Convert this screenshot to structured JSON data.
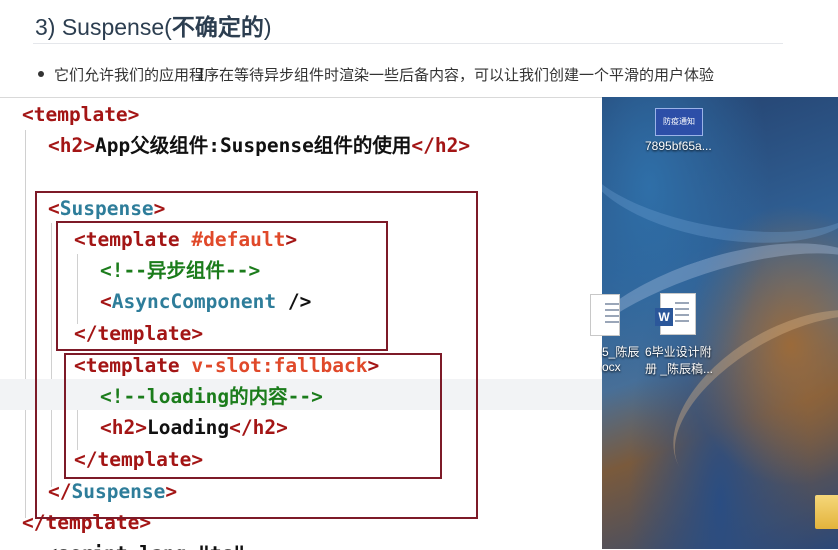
{
  "doc": {
    "heading_prefix": "3) Suspense(",
    "heading_bold": "不确定的",
    "heading_suffix": ")",
    "bullet_text": "它们允许我们的应用程序在等待异步组件时渲染一些后备内容，可以让我们创建一个平滑的用户体验"
  },
  "code": {
    "l1": {
      "open": "<",
      "tag": "template",
      "close": ">"
    },
    "l2": {
      "open": "<",
      "tag": "h2",
      "close": ">",
      "text": "App父级组件:Suspense组件的使用",
      "end_open": "</",
      "end_tag": "h2",
      "end_close": ">"
    },
    "l4": {
      "open": "<",
      "tag": "Suspense",
      "close": ">"
    },
    "l5": {
      "open": "<",
      "tag": "template",
      "attr": "#default",
      "close": ">"
    },
    "l6": {
      "comment": "<!--异步组件-->"
    },
    "l7": {
      "open": "<",
      "tag": "AsyncComponent",
      "close": " />"
    },
    "l8": {
      "open": "</",
      "tag": "template",
      "close": ">"
    },
    "l9": {
      "open": "<",
      "tag": "template",
      "attr": "v-slot:fallback",
      "close": ">"
    },
    "l10": {
      "comment": "<!--loading的内容-->"
    },
    "l11": {
      "open": "<",
      "tag": "h2",
      "close": ">",
      "text": "Loading",
      "end_open": "</",
      "end_tag": "h2",
      "end_close": ">"
    },
    "l12": {
      "open": "</",
      "tag": "template",
      "close": ">"
    },
    "l13": {
      "open": "</",
      "tag": "Suspense",
      "close": ">"
    },
    "l14": {
      "open": "</",
      "tag": "template",
      "close": ">"
    },
    "l15": {
      "text": "  <script lang=\"ts\""
    }
  },
  "desktop": {
    "icon1_caption": "7895bf65a...",
    "icon1_badge": "防疫通知",
    "icon2_caption_a": "5_陈辰",
    "icon2_caption_b": "ocx",
    "icon3_caption_a": "6毕业设计附",
    "icon3_caption_b": "册 _陈辰稿..."
  },
  "colors": {
    "tag": "#a31515",
    "component": "#2e7d9a",
    "attribute": "#e0492a",
    "comment": "#1b7c1b",
    "box_border": "#7d1a28"
  }
}
